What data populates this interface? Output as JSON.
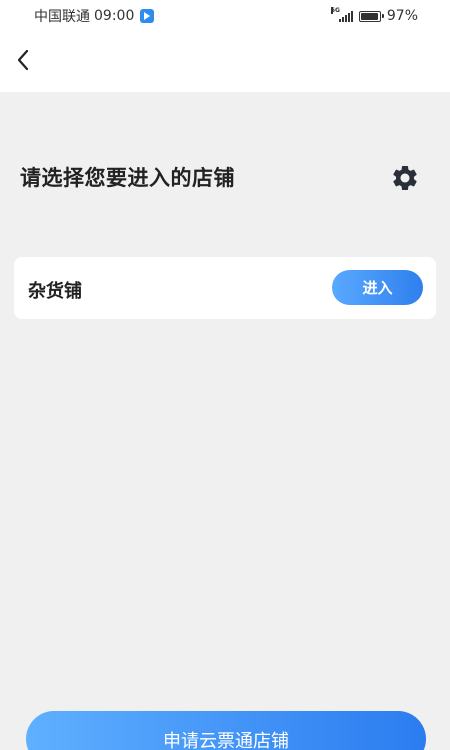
{
  "status_bar": {
    "carrier": "中国联通",
    "time": "09:00",
    "network": "5G",
    "battery": "97%",
    "battery_level": 0.97
  },
  "nav": {
    "back_icon": "chevron-left-icon"
  },
  "header": {
    "title": "请选择您要进入的店铺",
    "settings_icon": "gear-icon"
  },
  "stores": [
    {
      "name": "杂货铺",
      "enter_label": "进入"
    }
  ],
  "footer": {
    "apply_label": "申请云票通店铺"
  },
  "colors": {
    "accent": "#2f7fee",
    "accent_light": "#59a9ff",
    "background": "#f0f0f0"
  }
}
